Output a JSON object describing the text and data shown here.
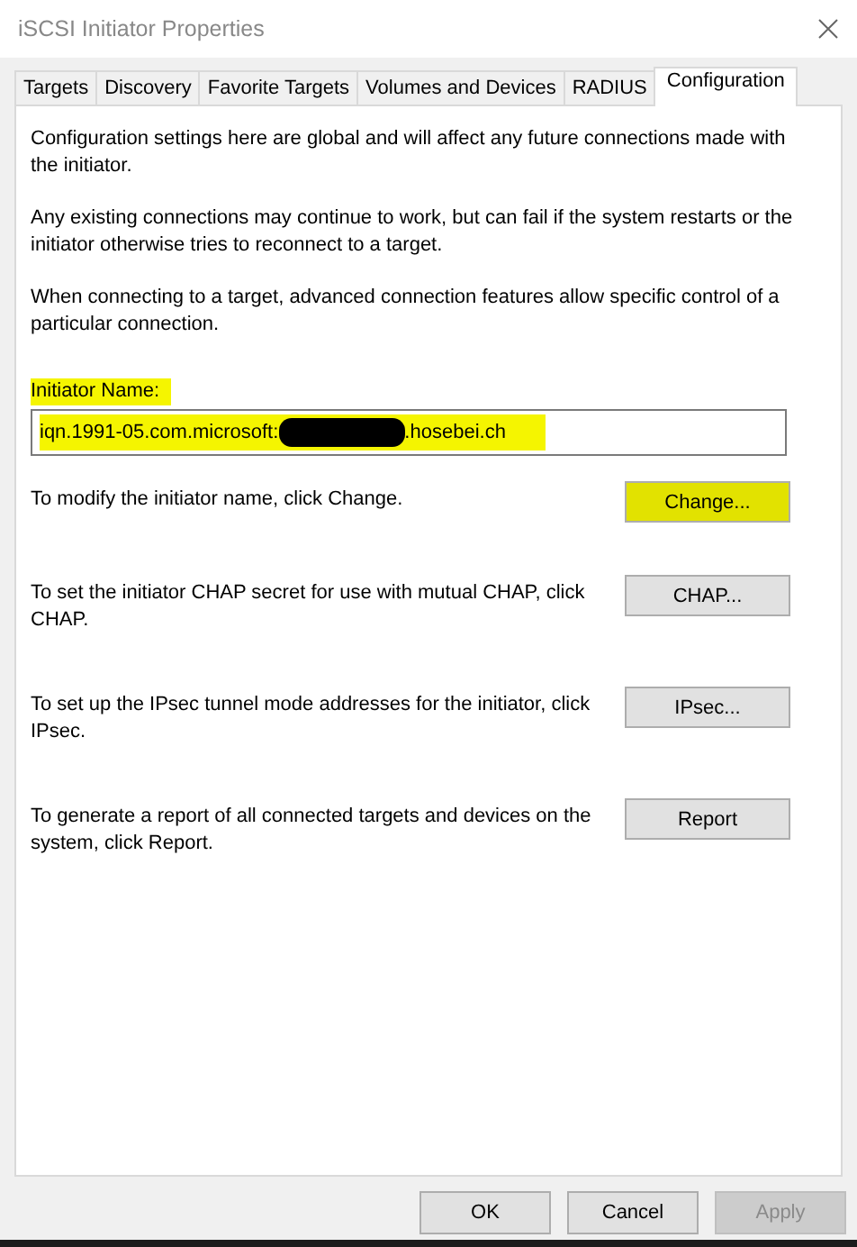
{
  "window": {
    "title": "iSCSI Initiator Properties"
  },
  "tabs": [
    {
      "label": "Targets",
      "selected": false
    },
    {
      "label": "Discovery",
      "selected": false
    },
    {
      "label": "Favorite Targets",
      "selected": false
    },
    {
      "label": "Volumes and Devices",
      "selected": false
    },
    {
      "label": "RADIUS",
      "selected": false
    },
    {
      "label": "Configuration",
      "selected": true
    }
  ],
  "intro": [
    "Configuration settings here are global and will affect any future connections made with the initiator.",
    "Any existing connections may continue to work, but can fail if the system restarts or the initiator otherwise tries to reconnect to a target.",
    "When connecting to a target, advanced connection features allow specific control of a particular connection."
  ],
  "initiator_name": {
    "label": "Initiator Name:",
    "label_highlighted": true,
    "value_start": "iqn.1991-05.com.microsoft:",
    "redacted": true,
    "value_end": ".hosebei.ch",
    "value_highlighted": true
  },
  "actions": [
    {
      "text": "To modify the initiator name, click Change.",
      "button": "Change...",
      "highlighted": true
    },
    {
      "text": "To set the initiator CHAP secret for use with mutual CHAP, click CHAP.",
      "button": "CHAP...",
      "highlighted": false
    },
    {
      "text": "To set up the IPsec tunnel mode addresses for the initiator, click IPsec.",
      "button": "IPsec...",
      "highlighted": false
    },
    {
      "text": "To generate a report of all connected targets and devices on the system, click Report.",
      "button": "Report",
      "highlighted": false
    }
  ],
  "dialog_buttons": [
    {
      "label": "OK",
      "disabled": false
    },
    {
      "label": "Cancel",
      "disabled": false
    },
    {
      "label": "Apply",
      "disabled": true
    }
  ]
}
